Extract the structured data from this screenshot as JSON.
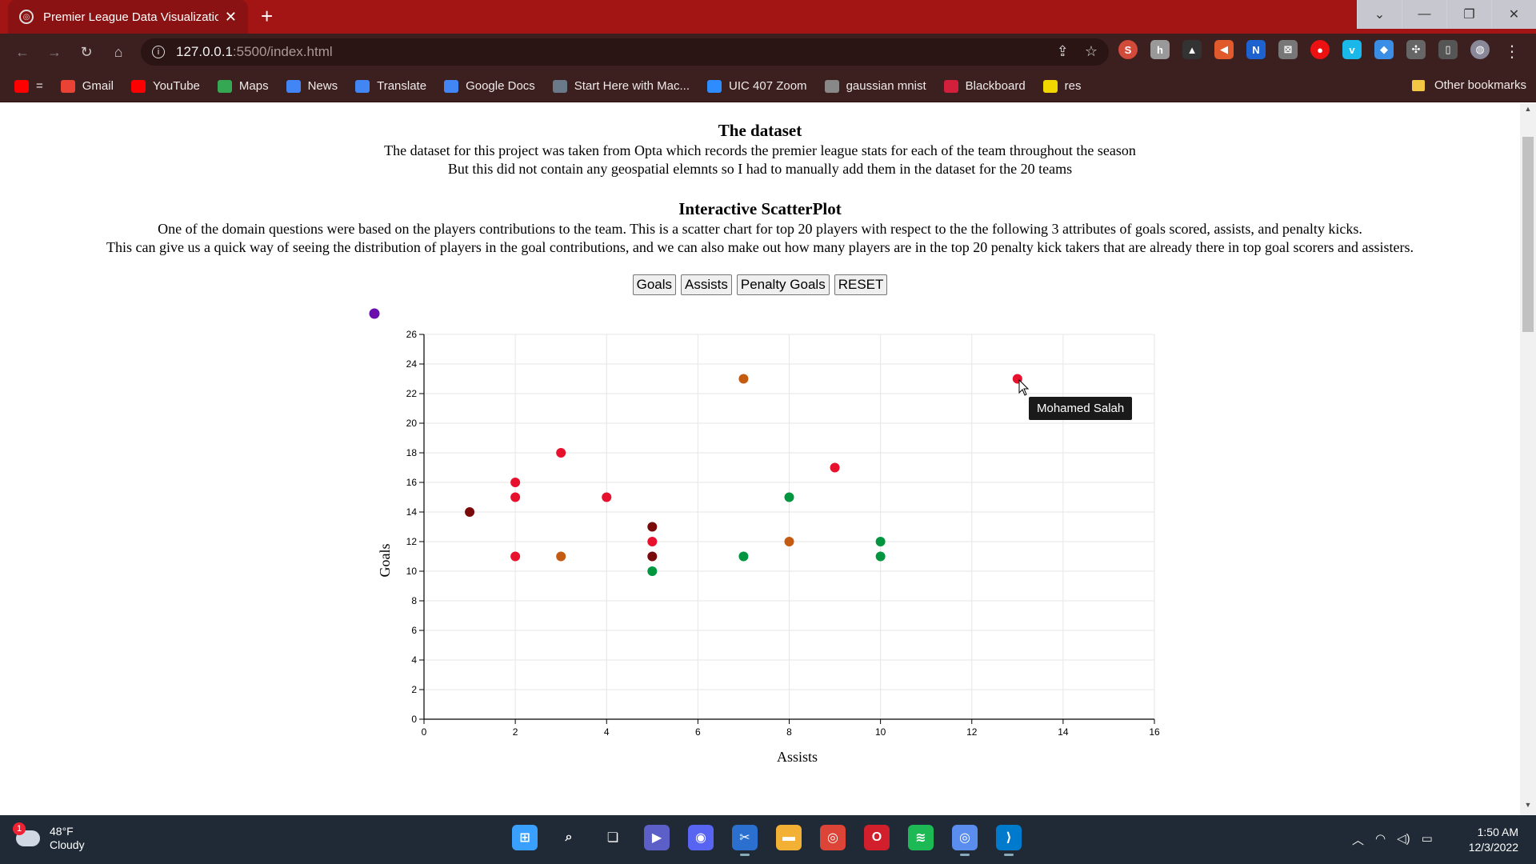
{
  "browser": {
    "tab_title": "Premier League Data Visualizatio",
    "tab_close": "✕",
    "new_tab": "+",
    "url_host": "127.0.0.1",
    "url_path": ":5500/index.html",
    "bookmarks": [
      {
        "label": "=",
        "icon": "youtube-icon",
        "color": "#ff0000"
      },
      {
        "label": "Gmail",
        "icon": "gmail-icon",
        "color": "#ea4335"
      },
      {
        "label": "YouTube",
        "icon": "youtube-icon",
        "color": "#ff0000"
      },
      {
        "label": "Maps",
        "icon": "maps-icon",
        "color": "#34a853"
      },
      {
        "label": "News",
        "icon": "news-icon",
        "color": "#4285f4"
      },
      {
        "label": "Translate",
        "icon": "translate-icon",
        "color": "#4285f4"
      },
      {
        "label": "Google Docs",
        "icon": "docs-icon",
        "color": "#4285f4"
      },
      {
        "label": "Start Here with Mac...",
        "icon": "bookmark-page-icon",
        "color": "#6b7a8a"
      },
      {
        "label": "UIC 407 Zoom",
        "icon": "zoom-icon",
        "color": "#2d8cff"
      },
      {
        "label": "gaussian mnist",
        "icon": "globe-icon",
        "color": "#888888"
      },
      {
        "label": "Blackboard",
        "icon": "blackboard-icon",
        "color": "#d21f3c"
      },
      {
        "label": "res",
        "icon": "res-icon",
        "color": "#f2d600"
      }
    ],
    "other_bookmarks": "Other bookmarks"
  },
  "page": {
    "dataset_title": "The dataset",
    "dataset_line1": "The dataset for this project was taken from Opta which records the premier league stats for each of the team throughout the season",
    "dataset_line2": "But this did not contain any geospatial elemnts so I had to manually add them in the dataset for the 20 teams",
    "scatter_title": "Interactive ScatterPlot",
    "scatter_line1": "One of the domain questions were based on the players contributions to the team. This is a scatter chart for top 20 players with respect to the the following 3 attributes of goals scored, assists, and penalty kicks.",
    "scatter_line2": "This can give us a quick way of seeing the distribution of players in the goal contributions, and we can also make out how many players are in the top 20 penalty kick takers that are already there in top goal scorers and assisters.",
    "buttons": {
      "goals": "Goals",
      "assists": "Assists",
      "penalty": "Penalty Goals",
      "reset": "RESET"
    },
    "tooltip": "Mohamed Salah"
  },
  "chart_data": {
    "type": "scatter",
    "xlabel": "Assists",
    "ylabel": "Goals",
    "xlim": [
      0,
      16
    ],
    "ylim": [
      0,
      26
    ],
    "xticks": [
      0,
      2,
      4,
      6,
      8,
      10,
      12,
      14,
      16
    ],
    "yticks": [
      0,
      2,
      4,
      6,
      8,
      10,
      12,
      14,
      16,
      18,
      20,
      22,
      24,
      26
    ],
    "grid": true,
    "colors": {
      "red": "#e8112d",
      "orange": "#c55a11",
      "maroon": "#7a0a0a",
      "green": "#00963f",
      "purple": "#6a0dad"
    },
    "points": [
      {
        "x": 13,
        "y": 23,
        "color": "red"
      },
      {
        "x": 7,
        "y": 23,
        "color": "orange"
      },
      {
        "x": 3,
        "y": 18,
        "color": "red"
      },
      {
        "x": 9,
        "y": 17,
        "color": "red"
      },
      {
        "x": 2,
        "y": 16,
        "color": "red"
      },
      {
        "x": 2,
        "y": 15,
        "color": "red"
      },
      {
        "x": 4,
        "y": 15,
        "color": "red"
      },
      {
        "x": 8,
        "y": 15,
        "color": "green"
      },
      {
        "x": 1,
        "y": 14,
        "color": "maroon"
      },
      {
        "x": 5,
        "y": 13,
        "color": "maroon"
      },
      {
        "x": 5,
        "y": 12,
        "color": "red"
      },
      {
        "x": 8,
        "y": 12,
        "color": "orange"
      },
      {
        "x": 10,
        "y": 12,
        "color": "green"
      },
      {
        "x": 2,
        "y": 11,
        "color": "red"
      },
      {
        "x": 3,
        "y": 11,
        "color": "orange"
      },
      {
        "x": 5,
        "y": 11,
        "color": "maroon"
      },
      {
        "x": 7,
        "y": 11,
        "color": "green"
      },
      {
        "x": 10,
        "y": 11,
        "color": "green"
      },
      {
        "x": 5,
        "y": 10,
        "color": "green"
      }
    ],
    "legend_marker_color": "purple"
  },
  "taskbar": {
    "weather_badge": "1",
    "temperature": "48°F",
    "condition": "Cloudy",
    "time": "1:50 AM",
    "date": "12/3/2022",
    "apps": [
      {
        "name": "start-icon",
        "color": "#3aa0ff"
      },
      {
        "name": "search-icon",
        "color": "#202a36"
      },
      {
        "name": "task-view-icon",
        "color": "#202a36"
      },
      {
        "name": "teams-chat-icon",
        "color": "#5b5fc7"
      },
      {
        "name": "discord-icon",
        "color": "#5865f2"
      },
      {
        "name": "snipping-tool-icon",
        "color": "#2b6fcf"
      },
      {
        "name": "file-explorer-icon",
        "color": "#f2b134"
      },
      {
        "name": "chrome-icon",
        "color": "#db4437"
      },
      {
        "name": "opera-icon",
        "color": "#d11f2c"
      },
      {
        "name": "spotify-icon",
        "color": "#1db954"
      },
      {
        "name": "chrome-dev-icon",
        "color": "#5a8dee"
      },
      {
        "name": "vscode-icon",
        "color": "#007acc"
      }
    ]
  }
}
